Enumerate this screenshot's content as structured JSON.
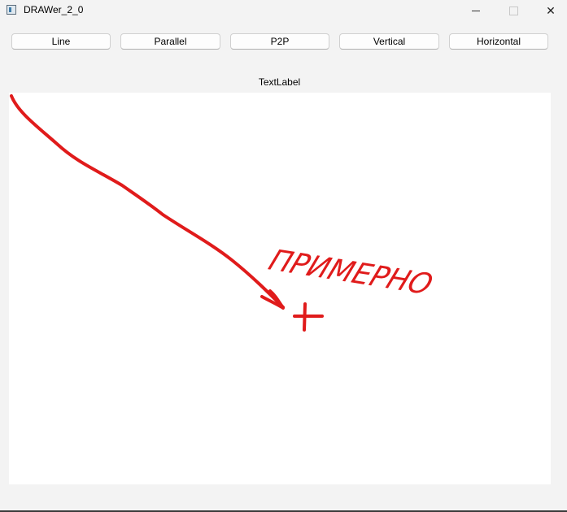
{
  "window": {
    "title": "DRAWer_2_0",
    "minimize_icon": "minimize-icon",
    "maximize_icon": "maximize-icon",
    "close_glyph": "✕"
  },
  "toolbar": {
    "buttons": [
      {
        "label": "Line"
      },
      {
        "label": "Parallel"
      },
      {
        "label": "P2P"
      },
      {
        "label": "Vertical"
      },
      {
        "label": "Horizontal"
      }
    ]
  },
  "label": {
    "text": "TextLabel"
  },
  "annotation": {
    "text": "ПРИМЕРНО",
    "color": "#e01b1b"
  }
}
